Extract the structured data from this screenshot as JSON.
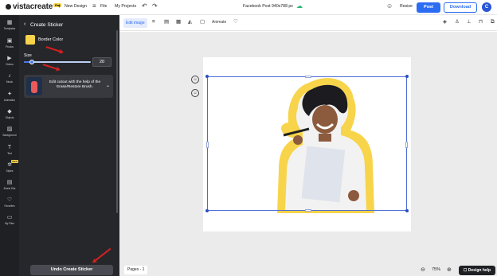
{
  "topbar": {
    "brand": "vistacreate",
    "pro_badge": "Pro",
    "new_design": "New Design",
    "file": "File",
    "my_projects": "My Projects",
    "doc_title": "Facebook Post 940x788 px",
    "resize": "Resize",
    "post": "Post",
    "download": "Download",
    "avatar_letter": "C",
    "accent_color": "#2b6cf2"
  },
  "rail": {
    "items": [
      {
        "label": "Templates",
        "icon": "templates-icon"
      },
      {
        "label": "Photos",
        "icon": "photos-icon"
      },
      {
        "label": "Videos",
        "icon": "videos-icon"
      },
      {
        "label": "Music",
        "icon": "music-icon"
      },
      {
        "label": "Animation",
        "icon": "animation-icon"
      },
      {
        "label": "Objects",
        "icon": "objects-icon"
      },
      {
        "label": "Background",
        "icon": "background-icon"
      },
      {
        "label": "Text",
        "icon": "text-icon"
      },
      {
        "label": "Styles",
        "icon": "styles-icon"
      },
      {
        "label": "Brand Kits",
        "icon": "brand-kits-icon"
      },
      {
        "label": "Favorites",
        "icon": "favorites-icon"
      },
      {
        "label": "My Files",
        "icon": "my-files-icon"
      }
    ],
    "new_badge": "NEW"
  },
  "panel": {
    "title": "Create Sticker",
    "border_color_label": "Border Color",
    "border_color": "#f7d44a",
    "size_label": "Size",
    "size_value": "20",
    "size_fraction": 0.12,
    "tip_text": "Edit cutout with the help of the Erase/Restore Brush.",
    "undo_label": "Undo Create Sticker"
  },
  "toolbar": {
    "edit_image": "Edit image",
    "animate": "Animate"
  },
  "footer": {
    "pages": "Pages - 1",
    "zoom": "75%",
    "design_help": "Design help"
  }
}
